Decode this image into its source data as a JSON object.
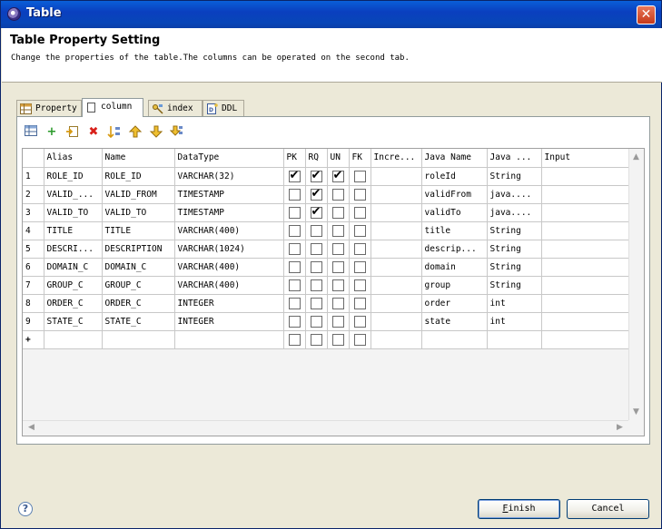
{
  "window": {
    "title": "Table",
    "close_glyph": "✕"
  },
  "header": {
    "title": "Table Property Setting",
    "description": "Change the properties of the table.The columns can be operated on the second tab."
  },
  "tabs": [
    {
      "label": "Property",
      "icon": "table-icon"
    },
    {
      "label": "column",
      "icon": "blank-page-icon"
    },
    {
      "label": "index",
      "icon": "index-icon"
    },
    {
      "label": "DDL",
      "icon": "ddl-file-icon"
    }
  ],
  "toolbar": {
    "icons": [
      "grid-view-icon",
      "add-icon",
      "insert-icon",
      "delete-icon",
      "sort-icon",
      "move-up-icon",
      "move-down-icon",
      "move-bottom-icon"
    ]
  },
  "grid": {
    "columns": [
      "",
      "Alias",
      "Name",
      "DataType",
      "PK",
      "RQ",
      "UN",
      "FK",
      "Incre...",
      "Java Name",
      "Java ...",
      "Input"
    ],
    "rows": [
      {
        "n": "1",
        "alias": "ROLE_ID",
        "name": "ROLE_ID",
        "type": "VARCHAR(32)",
        "pk": true,
        "rq": true,
        "un": true,
        "fk": false,
        "incre": "",
        "java_name": "roleId",
        "java_type": "String",
        "input": ""
      },
      {
        "n": "2",
        "alias": "VALID_...",
        "name": "VALID_FROM",
        "type": "TIMESTAMP",
        "pk": false,
        "rq": true,
        "un": false,
        "fk": false,
        "incre": "",
        "java_name": "validFrom",
        "java_type": "java....",
        "input": ""
      },
      {
        "n": "3",
        "alias": "VALID_TO",
        "name": "VALID_TO",
        "type": "TIMESTAMP",
        "pk": false,
        "rq": true,
        "un": false,
        "fk": false,
        "incre": "",
        "java_name": "validTo",
        "java_type": "java....",
        "input": ""
      },
      {
        "n": "4",
        "alias": "TITLE",
        "name": "TITLE",
        "type": "VARCHAR(400)",
        "pk": false,
        "rq": false,
        "un": false,
        "fk": false,
        "incre": "",
        "java_name": "title",
        "java_type": "String",
        "input": ""
      },
      {
        "n": "5",
        "alias": "DESCRI...",
        "name": "DESCRIPTION",
        "type": "VARCHAR(1024)",
        "pk": false,
        "rq": false,
        "un": false,
        "fk": false,
        "incre": "",
        "java_name": "descrip...",
        "java_type": "String",
        "input": ""
      },
      {
        "n": "6",
        "alias": "DOMAIN_C",
        "name": "DOMAIN_C",
        "type": "VARCHAR(400)",
        "pk": false,
        "rq": false,
        "un": false,
        "fk": false,
        "incre": "",
        "java_name": "domain",
        "java_type": "String",
        "input": ""
      },
      {
        "n": "7",
        "alias": "GROUP_C",
        "name": "GROUP_C",
        "type": "VARCHAR(400)",
        "pk": false,
        "rq": false,
        "un": false,
        "fk": false,
        "incre": "",
        "java_name": "group",
        "java_type": "String",
        "input": ""
      },
      {
        "n": "8",
        "alias": "ORDER_C",
        "name": "ORDER_C",
        "type": "INTEGER",
        "pk": false,
        "rq": false,
        "un": false,
        "fk": false,
        "incre": "",
        "java_name": "order",
        "java_type": "int",
        "input": ""
      },
      {
        "n": "9",
        "alias": "STATE_C",
        "name": "STATE_C",
        "type": "INTEGER",
        "pk": false,
        "rq": false,
        "un": false,
        "fk": false,
        "incre": "",
        "java_name": "state",
        "java_type": "int",
        "input": ""
      }
    ],
    "add_row_marker": "+"
  },
  "footer": {
    "help_glyph": "?",
    "finish_label": "Finish",
    "cancel_label": "Cancel"
  }
}
